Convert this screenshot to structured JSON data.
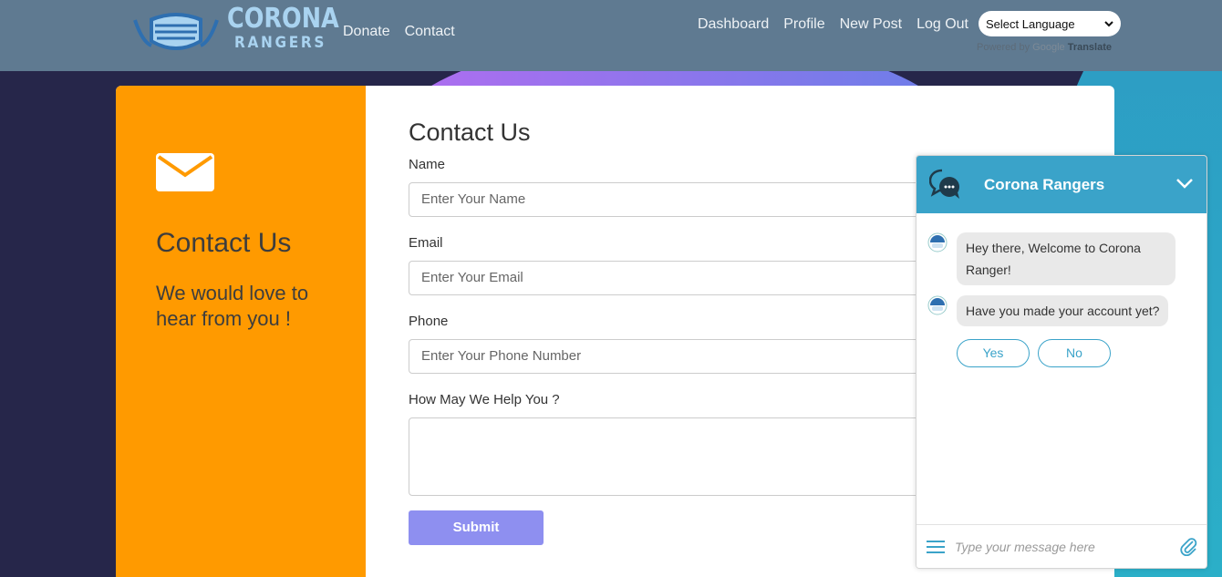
{
  "header": {
    "logo_line1": "CORONA",
    "logo_line2": "RANGERS",
    "nav_left": [
      "Donate",
      "Contact"
    ],
    "nav_right": [
      "Dashboard",
      "Profile",
      "New Post",
      "Log Out"
    ],
    "language_select": "Select Language",
    "powered_by": "Powered by",
    "google": "Google",
    "translate": "Translate"
  },
  "contact_left": {
    "icon": "envelope-icon",
    "title": "Contact Us",
    "subtitle": "We would love to hear from you !"
  },
  "form": {
    "title": "Contact Us",
    "name_label": "Name",
    "name_placeholder": "Enter Your Name",
    "email_label": "Email",
    "email_placeholder": "Enter Your Email",
    "phone_label": "Phone",
    "phone_placeholder": "Enter Your Phone Number",
    "help_label": "How May We Help You ?",
    "submit_label": "Submit"
  },
  "chat": {
    "title": "Corona Rangers",
    "messages": [
      "Hey there, Welcome to Corona Ranger!",
      "Have you made your account yet?"
    ],
    "quick_replies": [
      "Yes",
      "No"
    ],
    "input_placeholder": "Type your message here"
  },
  "colors": {
    "header_bg": "#5f7a91",
    "left_panel": "#ff9a00",
    "submit_bg": "#8e8ff0",
    "chat_accent": "#3aa3c9",
    "page_bg": "#26264a"
  }
}
